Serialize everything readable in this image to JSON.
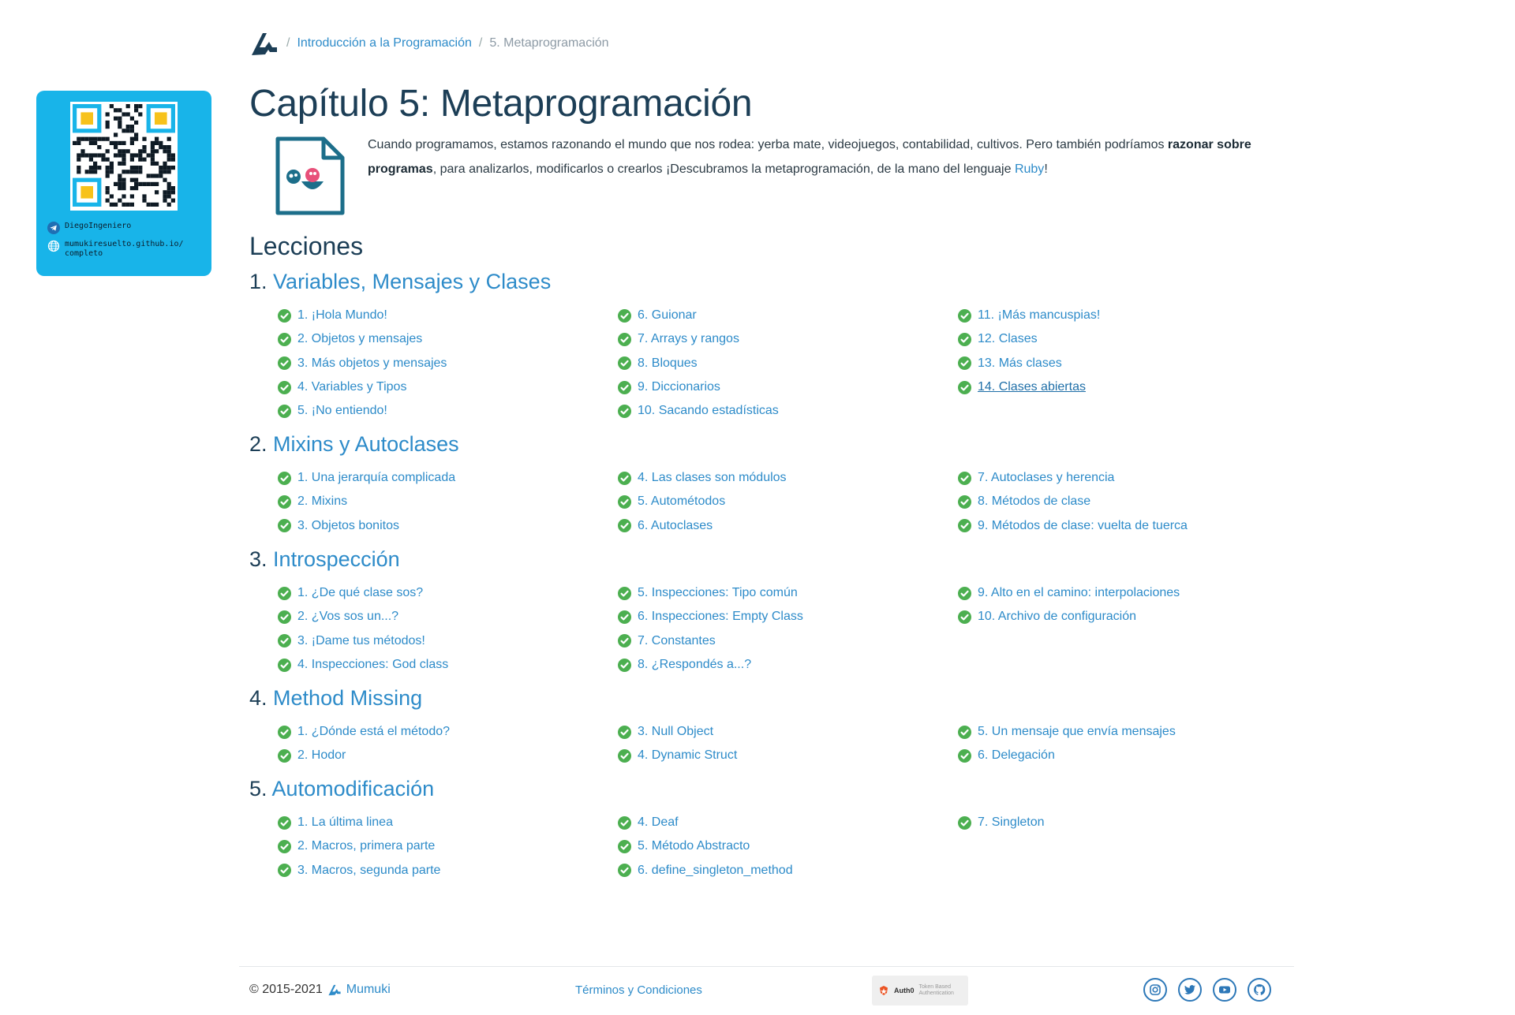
{
  "sidebar_card": {
    "telegram": "DiegoIngeniero",
    "website_line1": "mumukiresuelto.github.io/",
    "website_line2": "completo",
    "accent_color": "#18b4e9"
  },
  "breadcrumb": {
    "course": "Introducción a la Programación",
    "current": "5. Metaprogramación"
  },
  "page_title": "Capítulo 5: Metaprogramación",
  "description": {
    "part1": "Cuando programamos, estamos razonando el mundo que nos rodea: yerba mate, videojuegos, contabilidad, cultivos. Pero también podríamos ",
    "bold": "razonar sobre programas",
    "part2": ", para analizarlos, modificarlos o crearlos ¡Descubramos la metaprogramación, de la mano del lenguaje ",
    "link": "Ruby",
    "part3": "!"
  },
  "lessons_heading": "Lecciones",
  "chapters": [
    {
      "number": "1.",
      "title": "Variables, Mensajes y Clases",
      "columns": [
        [
          "1. ¡Hola Mundo!",
          "2. Objetos y mensajes",
          "3. Más objetos y mensajes",
          "4. Variables y Tipos",
          "5. ¡No entiendo!"
        ],
        [
          "6. Guionar",
          "7. Arrays y rangos",
          "8. Bloques",
          "9. Diccionarios",
          "10. Sacando estadísticas"
        ],
        [
          "11. ¡Más mancuspias!",
          "12. Clases",
          "13. Más clases",
          "14. Clases abiertas"
        ]
      ]
    },
    {
      "number": "2.",
      "title": "Mixins y Autoclases",
      "columns": [
        [
          "1. Una jerarquía complicada",
          "2. Mixins",
          "3. Objetos bonitos"
        ],
        [
          "4. Las clases son módulos",
          "5. Autométodos",
          "6. Autoclases"
        ],
        [
          "7. Autoclases y herencia",
          "8. Métodos de clase",
          "9. Métodos de clase: vuelta de tuerca"
        ]
      ]
    },
    {
      "number": "3.",
      "title": "Introspección",
      "columns": [
        [
          "1. ¿De qué clase sos?",
          "2. ¿Vos sos un...?",
          "3. ¡Dame tus métodos!",
          "4. Inspecciones: God class"
        ],
        [
          "5. Inspecciones: Tipo común",
          "6. Inspecciones: Empty Class",
          "7. Constantes",
          "8. ¿Respondés a...?"
        ],
        [
          "9. Alto en el camino: interpolaciones",
          "10. Archivo de configuración"
        ]
      ]
    },
    {
      "number": "4.",
      "title": "Method Missing",
      "columns": [
        [
          "1. ¿Dónde está el método?",
          "2. Hodor"
        ],
        [
          "3. Null Object",
          "4. Dynamic Struct"
        ],
        [
          "5. Un mensaje que envía mensajes",
          "6. Delegación"
        ]
      ]
    },
    {
      "number": "5.",
      "title": "Automodificación",
      "columns": [
        [
          "1. La última linea",
          "2. Macros, primera parte",
          "3. Macros, segunda parte"
        ],
        [
          "4. Deaf",
          "5. Método Abstracto",
          "6. define_singleton_method"
        ],
        [
          "7. Singleton"
        ]
      ]
    }
  ],
  "footer": {
    "copyright": "© 2015-2021",
    "brand": "Mumuki",
    "terms": "Términos y Condiciones",
    "auth_badge_name": "Auth0",
    "auth_badge_sub": "Token Based Authentication",
    "socials": [
      "instagram-icon",
      "twitter-icon",
      "youtube-icon",
      "github-icon"
    ]
  },
  "colors": {
    "link": "#2d8bc9",
    "heading": "#1c3e56",
    "check": "#4caf50"
  }
}
